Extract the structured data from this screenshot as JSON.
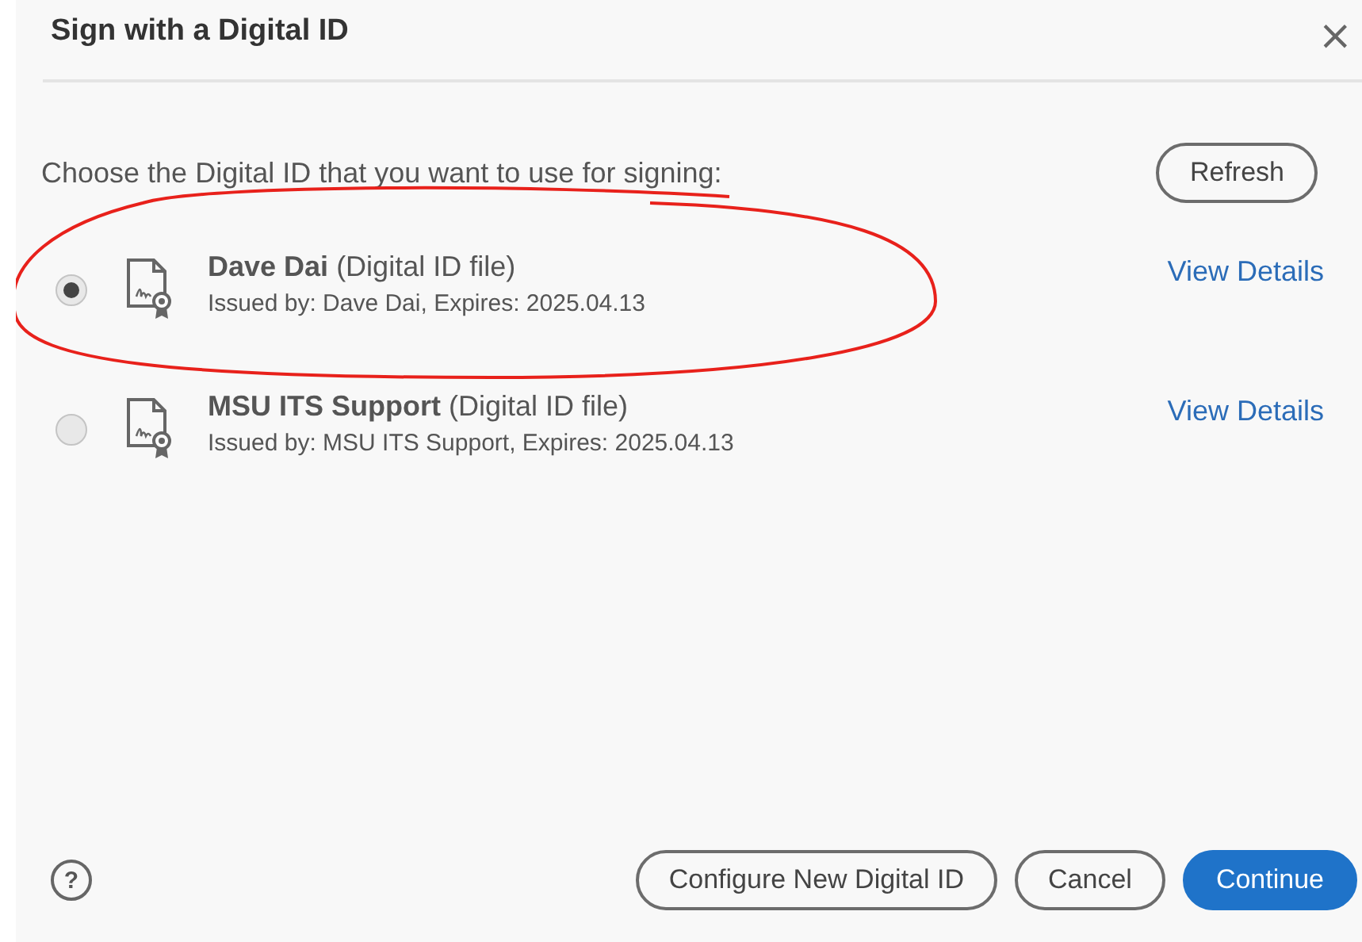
{
  "dialog": {
    "title": "Sign with a Digital ID",
    "close": "×"
  },
  "instruction": "Choose the Digital ID that you want to use for signing:",
  "refresh_button": "Refresh",
  "ids": [
    {
      "name": "Dave Dai",
      "type": "(Digital ID file)",
      "details": "Issued by: Dave Dai, Expires: 2025.04.13",
      "link": "View Details",
      "selected": true
    },
    {
      "name": "MSU ITS Support",
      "type": "(Digital ID file)",
      "details": "Issued by: MSU ITS Support, Expires: 2025.04.13",
      "link": "View Details",
      "selected": false
    }
  ],
  "footer": {
    "help": "?",
    "buttons": [
      {
        "label": "Configure New Digital ID",
        "kind": "outline"
      },
      {
        "label": "Cancel",
        "kind": "outline"
      },
      {
        "label": "Continue",
        "kind": "primary"
      }
    ]
  }
}
